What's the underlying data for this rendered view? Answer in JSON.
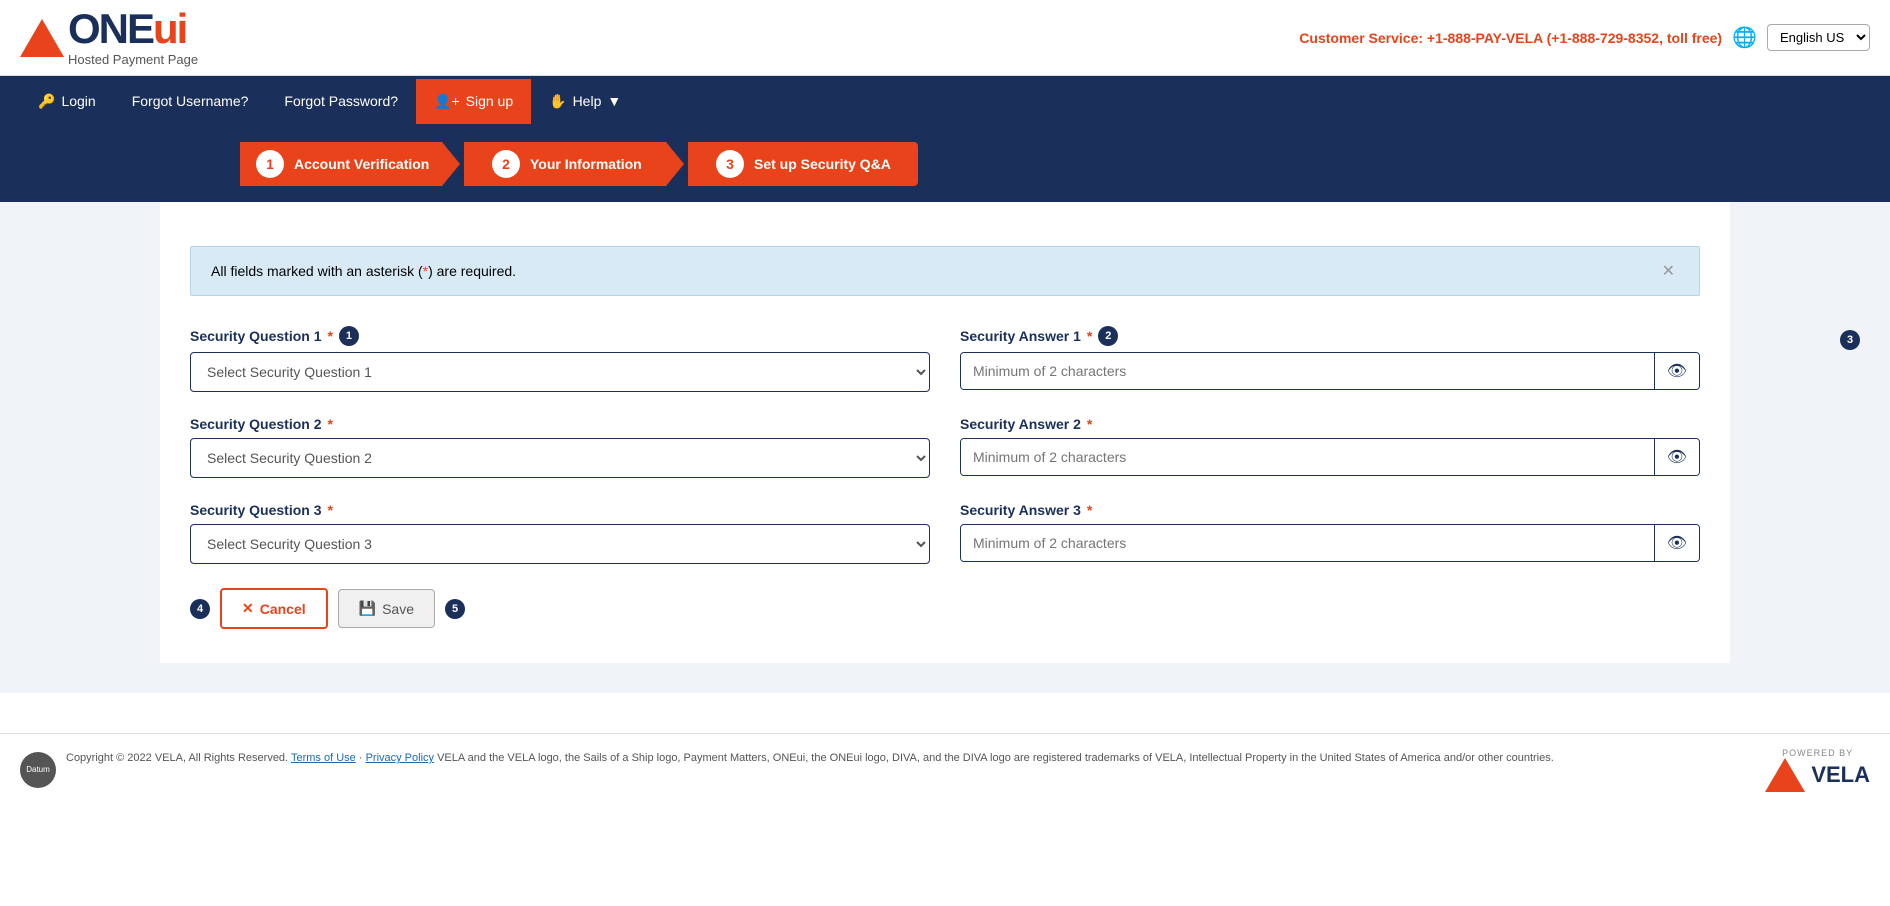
{
  "header": {
    "logo_brand": "ONEui",
    "logo_subtitle": "Hosted Payment Page",
    "customer_service": "Customer Service: +1-888-PAY-VELA (+1-888-729-8352, toll free)",
    "language": "English US"
  },
  "nav": {
    "items": [
      {
        "label": "Login",
        "icon": "→",
        "active": false
      },
      {
        "label": "Forgot Username?",
        "icon": "",
        "active": false
      },
      {
        "label": "Forgot Password?",
        "icon": "",
        "active": false
      },
      {
        "label": "Sign up",
        "icon": "👤",
        "active": true
      },
      {
        "label": "Help",
        "icon": "✋",
        "active": false,
        "has_dropdown": true
      }
    ]
  },
  "steps": [
    {
      "number": "1",
      "label": "Account Verification",
      "active": true
    },
    {
      "number": "2",
      "label": "Your Information",
      "active": true
    },
    {
      "number": "3",
      "label": "Set up Security Q&A",
      "active": true
    }
  ],
  "alert": {
    "message": "All fields marked with an asterisk (*) are required."
  },
  "form": {
    "security_question_1_label": "Security Question 1",
    "security_question_1_placeholder": "Select Security Question 1",
    "security_answer_1_label": "Security Answer 1",
    "security_answer_1_placeholder": "Minimum of 2 characters",
    "security_question_2_label": "Security Question 2",
    "security_question_2_placeholder": "Select Security Question 2",
    "security_answer_2_label": "Security Answer 2",
    "security_answer_2_placeholder": "Minimum of 2 characters",
    "security_question_3_label": "Security Question 3",
    "security_question_3_placeholder": "Select Security Question 3",
    "security_answer_3_label": "Security Answer 3",
    "security_answer_3_placeholder": "Minimum of 2 characters"
  },
  "buttons": {
    "cancel_label": "Cancel",
    "save_label": "Save"
  },
  "footer": {
    "copyright": "Copyright © 2022 VELA, All Rights Reserved.",
    "terms_label": "Terms of Use",
    "privacy_label": "Privacy Policy",
    "description": " VELA and the VELA logo, the Sails of a Ship logo, Payment Matters, ONEui, the ONEui logo, DIVA, and the DIVA logo are registered trademarks of VELA, Intellectual Property in the United States of America and/or other countries.",
    "powered_by": "POWERED BY",
    "vela_brand": "VELA"
  }
}
